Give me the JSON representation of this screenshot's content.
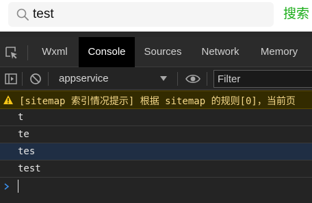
{
  "search": {
    "value": "test",
    "button_label": "搜索"
  },
  "devtools": {
    "tabs": [
      {
        "label": "Wxml",
        "active": false
      },
      {
        "label": "Console",
        "active": true
      },
      {
        "label": "Sources",
        "active": false
      },
      {
        "label": "Network",
        "active": false
      },
      {
        "label": "Memory",
        "active": false
      }
    ],
    "toolbar": {
      "context": "appservice",
      "filter_placeholder": "Filter"
    }
  },
  "console": {
    "warning": "[sitemap 索引情况提示] 根据 sitemap 的规则[0]，当前页",
    "logs": [
      "t",
      "te",
      "tes",
      "test"
    ]
  },
  "colors": {
    "accent_green": "#1aad19",
    "warning_text": "#f5d88a",
    "warning_bg": "#332b00",
    "prompt_blue": "#3b8eea"
  },
  "icons": [
    "search-icon",
    "inspect-element-icon",
    "toggle-sidebar-icon",
    "clear-console-icon",
    "chevron-down-icon",
    "eye-icon",
    "warning-icon",
    "prompt-chevron-icon"
  ]
}
